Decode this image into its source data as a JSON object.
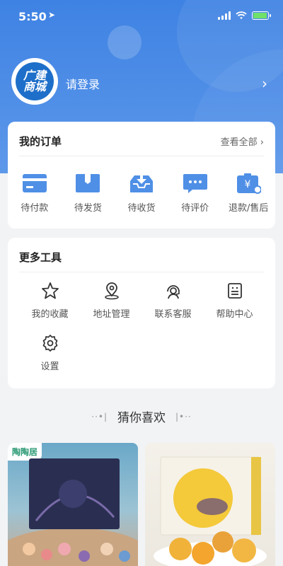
{
  "status_bar": {
    "time": "5:50",
    "location_icon": "location-arrow-icon",
    "battery": "charging"
  },
  "header": {
    "logo_line1": "广建",
    "logo_line2": "商城",
    "login_text": "请登录",
    "arrow": "›"
  },
  "orders": {
    "title": "我的订单",
    "view_all": "查看全部 ›",
    "items": [
      {
        "label": "待付款",
        "icon": "card-icon"
      },
      {
        "label": "待发货",
        "icon": "box-icon"
      },
      {
        "label": "待收货",
        "icon": "inbox-icon"
      },
      {
        "label": "待评价",
        "icon": "chat-icon"
      },
      {
        "label": "退款/售后",
        "icon": "refund-icon"
      }
    ]
  },
  "tools": {
    "title": "更多工具",
    "items": [
      {
        "label": "我的收藏",
        "icon": "star-icon"
      },
      {
        "label": "地址管理",
        "icon": "map-pin-icon"
      },
      {
        "label": "联系客服",
        "icon": "headset-icon"
      },
      {
        "label": "帮助中心",
        "icon": "help-icon"
      },
      {
        "label": "设置",
        "icon": "gear-icon"
      }
    ]
  },
  "recommend": {
    "title": "猜你喜欢",
    "deco_left": "··•|",
    "deco_right": "|•··"
  },
  "products": [
    {
      "tag": "陶陶居"
    },
    {
      "tag": ""
    }
  ],
  "colors": {
    "primary": "#3e82e3",
    "icon_blue": "#4f8fe6"
  }
}
